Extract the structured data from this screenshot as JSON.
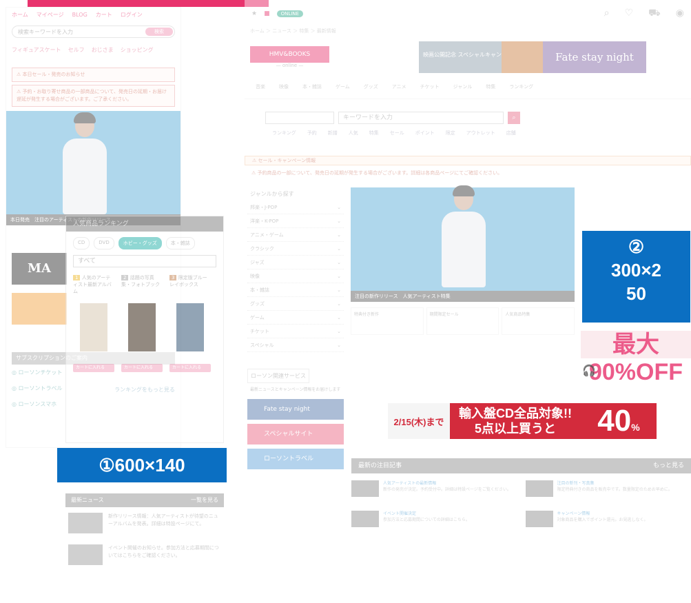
{
  "mobile": {
    "nav": [
      "ホーム",
      "マイページ",
      "BLOG",
      "カート",
      "ログイン"
    ],
    "search_placeholder": "検索キーワードを入力",
    "search_button": "検索",
    "links": [
      "フィギュアスケート",
      "セルフ",
      "おじさま",
      "ショッピング"
    ],
    "notice1": "本日セール・発売のお知らせ",
    "notice2": "予約・お取り寄せ商品の一部商品について、発売日の延期・お届け遅延が発生する場合がございます。ご了承ください。",
    "hero_caption": "本日発売　注目のアーティストの新作リリース",
    "subscription_label": "サブスクリプションのご案内",
    "sidebar_links": [
      "ローソンチケット",
      "ローソントラベル",
      "ローソンスマホ"
    ]
  },
  "ranking": {
    "title": "人気商品ランキング",
    "tabs": [
      "CD",
      "DVD",
      "ホビー・グッズ",
      "本・雑誌"
    ],
    "select_value": "すべて",
    "items": [
      {
        "rank": "1",
        "title": "人気のアーティスト最新アルバム"
      },
      {
        "rank": "2",
        "title": "話題の写真集・フォトブック"
      },
      {
        "rank": "3",
        "title": "限定版ブルーレイボックス"
      }
    ],
    "cart_label": "カートに入れる",
    "more_link": "ランキングをもっと見る"
  },
  "labels": {
    "label1": "①600×140",
    "label2_line1": "②",
    "label2_line2": "300×2",
    "label2_line3": "50"
  },
  "news_left": {
    "title": "最新ニュース",
    "more": "一覧を見る",
    "items": [
      {
        "text": "新作リリース情報：人気アーティストが待望のニューアルバムを発表。詳細は特設ページにて。"
      },
      {
        "text": "イベント開催のお知らせ。参加方法と応募期間についてはこちらをご確認ください。"
      }
    ]
  },
  "desktop": {
    "badge": "ONLINE",
    "store_label": "HMV&BOOKS",
    "store_sub": "— online —",
    "banner_text": "映画公開記念 スペシャルキャンペーン",
    "banner2_text": "Fate stay night",
    "crumb": "ホーム ＞ ニュース ＞ 特集 ＞ 最新情報",
    "menu": [
      "音楽",
      "映像",
      "本・雑誌",
      "ゲーム",
      "グッズ",
      "アニメ",
      "チケット",
      "ジャンル",
      "特集",
      "ランキング"
    ],
    "search_placeholder": "キーワードを入力",
    "tags": [
      "ランキング",
      "予約",
      "新譜",
      "人気",
      "特集",
      "セール",
      "ポイント",
      "限定",
      "アウトレット",
      "店舗"
    ],
    "note1": "セール・キャンペーン情報",
    "note2": "予約商品の一部について、発売日の延期が発生する場合がございます。詳細は各商品ページにてご確認ください。",
    "side_heading": "ジャンルから探す",
    "side_items": [
      "邦楽・J-POP",
      "洋楽・K-POP",
      "アニメ・ゲーム",
      "クラシック",
      "ジャズ",
      "映像",
      "本・雑誌",
      "グッズ",
      "ゲーム",
      "チケット",
      "スペシャル"
    ],
    "hero_caption": "注目の新作リリース　人気アーティスト特集",
    "thumbs": [
      "特典付き新作",
      "期間限定セール",
      "人気商品特集"
    ],
    "sale_text": "最大90%OFF",
    "cd_date": "2/15(木)まで",
    "cd_line1": "輸入盤CD全品対象!!",
    "cd_line2": "5点以上買うと",
    "cd_percent": "40",
    "latest_title": "最新の注目記事",
    "latest_more": "もっと見る",
    "latest_items": [
      {
        "head": "人気アーティストの最新情報",
        "body": "新作の発売が決定。予約受付中。詳細は特設ページをご覧ください。"
      },
      {
        "head": "注目の新刊・写真集",
        "body": "限定特典付きの商品を販売中です。数量限定のためお早めに。"
      },
      {
        "head": "イベント開催決定",
        "body": "参加方法と応募期間についての詳細はこちら。"
      },
      {
        "head": "キャンペーン情報",
        "body": "対象商品を購入でポイント還元。お見逃しなく。"
      }
    ],
    "side_banners": [
      "Fate stay night",
      "スペシャルサイト",
      "ローソントラベル"
    ],
    "side_banner_colors": [
      "#4a6fa5",
      "#e95c7b",
      "#5aa0d8"
    ],
    "side_heading2": "ローソン関連サービス",
    "side_news": "最新ニュースとキャンペーン情報をお届けします"
  },
  "colors": {
    "accent_pink": "#e8336d",
    "label_blue": "#0b6fc2",
    "hero_blue": "#4fa7d6",
    "sale_red": "#d32b3c"
  }
}
